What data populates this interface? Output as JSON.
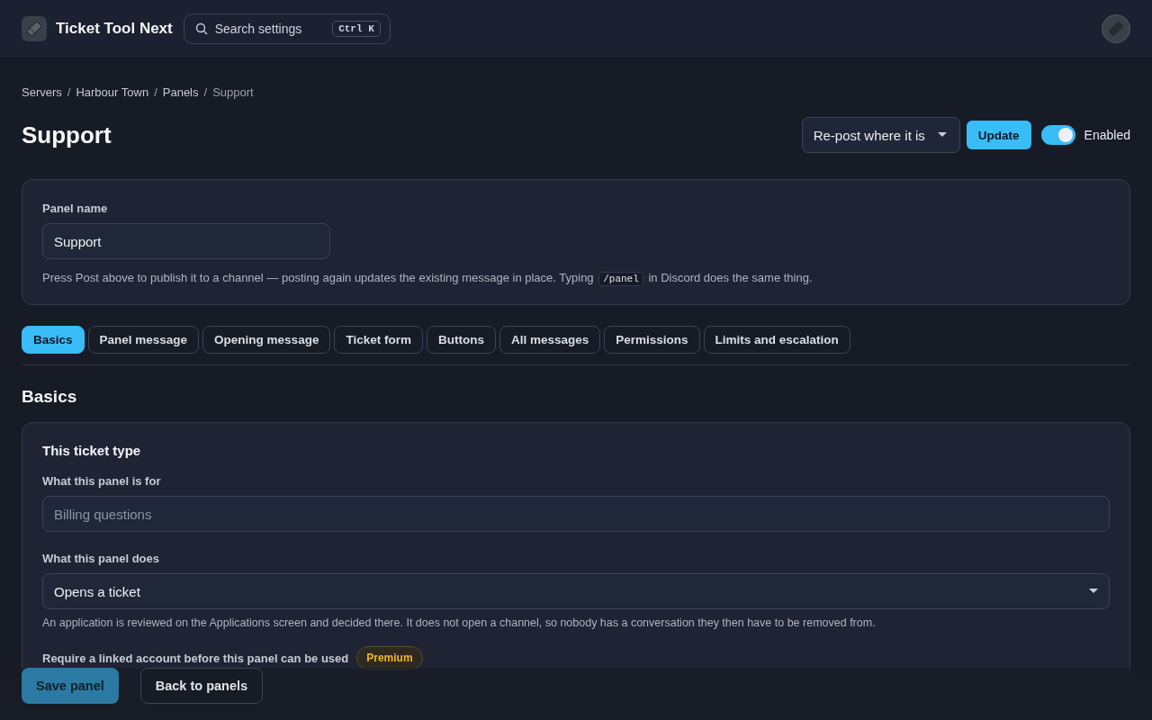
{
  "app": {
    "name": "Ticket Tool Next"
  },
  "search": {
    "placeholder": "Search settings",
    "shortcut": "Ctrl K"
  },
  "breadcrumb": [
    {
      "label": "Servers",
      "current": false
    },
    {
      "label": "Harbour Town",
      "current": false
    },
    {
      "label": "Panels",
      "current": false
    },
    {
      "label": "Support",
      "current": true
    }
  ],
  "breadcrumb_separator": "/",
  "page": {
    "title": "Support",
    "post_mode": "Re-post where it is",
    "update_button": "Update",
    "enabled": {
      "label": "Enabled",
      "on": true
    }
  },
  "panel_name": {
    "label": "Panel name",
    "value": "Support",
    "help_before": "Press Post above to publish it to a channel — posting again updates the existing message in place. Typing ",
    "help_code": "/panel",
    "help_after": " in Discord does the same thing."
  },
  "tabs": [
    {
      "label": "Basics",
      "selected": true
    },
    {
      "label": "Panel message",
      "selected": false
    },
    {
      "label": "Opening message",
      "selected": false
    },
    {
      "label": "Ticket form",
      "selected": false
    },
    {
      "label": "Buttons",
      "selected": false
    },
    {
      "label": "All messages",
      "selected": false
    },
    {
      "label": "Permissions",
      "selected": false
    },
    {
      "label": "Limits and escalation",
      "selected": false
    }
  ],
  "section": {
    "title": "Basics",
    "card_title": "This ticket type",
    "purpose": {
      "label": "What this panel is for",
      "placeholder": "Billing questions"
    },
    "action": {
      "label": "What this panel does",
      "value": "Opens a ticket",
      "help": "An application is reviewed on the Applications screen and decided there. It does not open a channel, so nobody has a conversation they then have to be removed from."
    },
    "linked_account": {
      "label": "Require a linked account before this panel can be used",
      "badge": "Premium"
    }
  },
  "footer": {
    "save": {
      "label": "Save panel",
      "disabled": true
    },
    "back": "Back to panels"
  }
}
